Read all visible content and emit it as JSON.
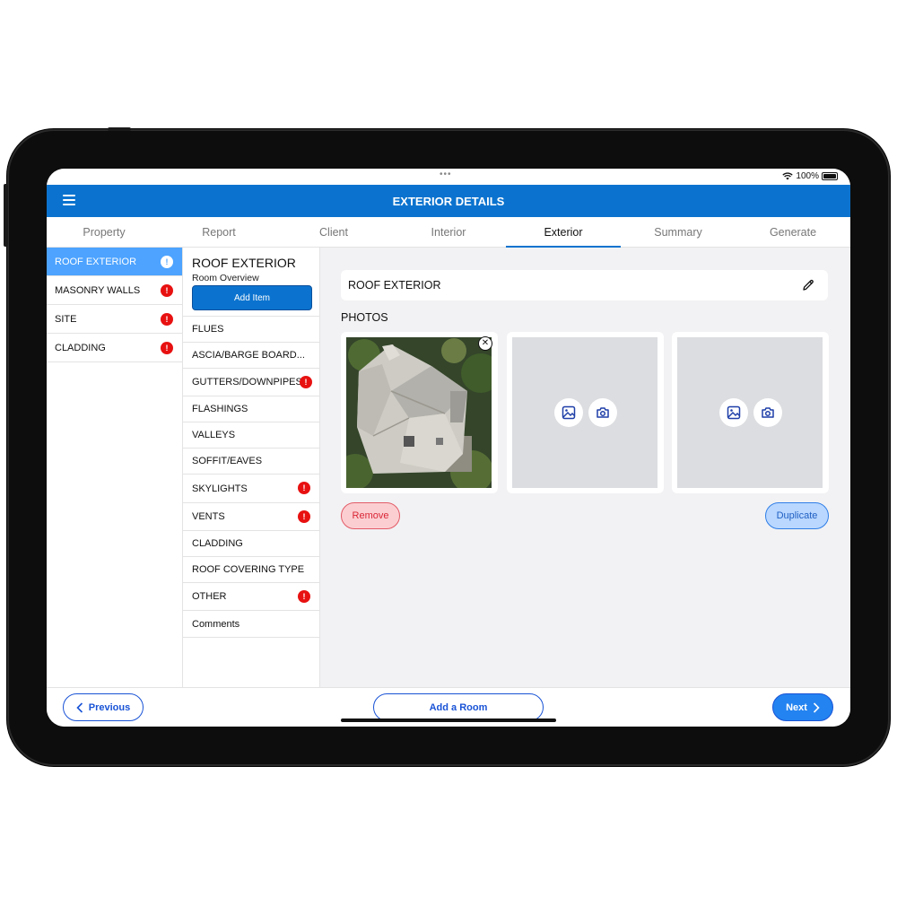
{
  "status_bar": {
    "dots": "•••",
    "battery_text": "100%"
  },
  "header": {
    "title": "EXTERIOR DETAILS"
  },
  "tabs": [
    {
      "label": "Property"
    },
    {
      "label": "Report"
    },
    {
      "label": "Client"
    },
    {
      "label": "Interior"
    },
    {
      "label": "Exterior"
    },
    {
      "label": "Summary"
    },
    {
      "label": "Generate"
    }
  ],
  "active_tab": "Exterior",
  "rooms": [
    {
      "label": "ROOF EXTERIOR",
      "badge": "!"
    },
    {
      "label": "MASONRY WALLS",
      "badge": "!"
    },
    {
      "label": "SITE",
      "badge": "!"
    },
    {
      "label": "CLADDING",
      "badge": "!"
    }
  ],
  "room_panel": {
    "title": "ROOF EXTERIOR",
    "subtitle": "Room Overview",
    "add_item_label": "Add Item",
    "items": [
      {
        "label": "FLUES",
        "badge": ""
      },
      {
        "label": "ASCIA/BARGE BOARD...",
        "badge": ""
      },
      {
        "label": "GUTTERS/DOWNPIPES",
        "badge": "!"
      },
      {
        "label": "FLASHINGS",
        "badge": ""
      },
      {
        "label": "VALLEYS",
        "badge": ""
      },
      {
        "label": "SOFFIT/EAVES",
        "badge": ""
      },
      {
        "label": "SKYLIGHTS",
        "badge": "!"
      },
      {
        "label": "VENTS",
        "badge": "!"
      },
      {
        "label": "CLADDING",
        "badge": ""
      },
      {
        "label": "ROOF COVERING TYPE",
        "badge": ""
      },
      {
        "label": "OTHER",
        "badge": "!"
      },
      {
        "label": "Comments",
        "badge": ""
      }
    ]
  },
  "main": {
    "name": "ROOF EXTERIOR",
    "photos_label": "PHOTOS",
    "remove_label": "Remove",
    "duplicate_label": "Duplicate"
  },
  "bottom": {
    "previous_label": "Previous",
    "add_room_label": "Add a Room",
    "next_label": "Next"
  },
  "colors": {
    "accent": "#0b73cf",
    "active_room": "#4da3ff",
    "alert_badge": "#e81111",
    "remove": "#d92535",
    "duplicate": "#1f5fc2"
  }
}
